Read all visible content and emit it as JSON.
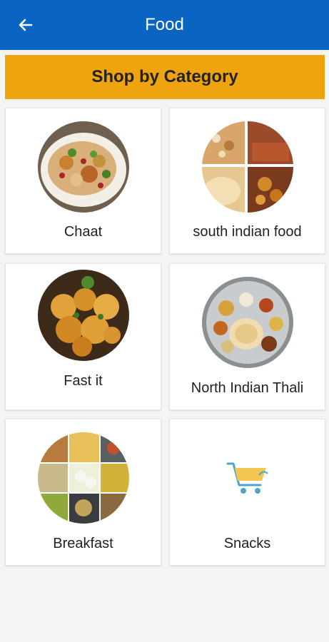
{
  "app_bar": {
    "title": "Food",
    "back_icon": "arrow-left-icon",
    "background": "#0a64c2"
  },
  "banner": {
    "title": "Shop by Category",
    "background": "#eda40f"
  },
  "categories": [
    {
      "label": "Chaat",
      "image": "chaat-photo"
    },
    {
      "label": "south indian food",
      "image": "south-indian-collage-photo"
    },
    {
      "label": "Fast it",
      "image": "fried-potatoes-photo"
    },
    {
      "label": "North Indian Thali",
      "image": "thali-photo"
    },
    {
      "label": "Breakfast",
      "image": "breakfast-collage-photo"
    },
    {
      "label": "Snacks",
      "image": "cart-icon"
    }
  ]
}
